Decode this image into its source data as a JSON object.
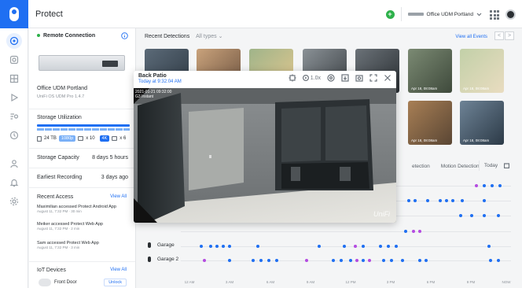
{
  "app": {
    "title": "Protect"
  },
  "topbar": {
    "console_name": "Office UDM Portland"
  },
  "panel": {
    "remote": {
      "label": "Remote Connection"
    },
    "device": {
      "name": "Office UDM Portland",
      "model": "UniFi OS UDM Pro 1.4.7"
    },
    "storage": {
      "title": "Storage Utilization",
      "capacity_label": "24 TB",
      "chip_1080": "1080p",
      "count_1080": "x 10",
      "chip_4k": "4K",
      "count_4k": "x 6"
    },
    "capacity": {
      "label": "Storage Capacity",
      "value": "8 days 5 hours"
    },
    "earliest": {
      "label": "Earliest Recording",
      "value": "3 days ago"
    },
    "recent_access": {
      "title": "Recent Access",
      "view_all": "View All",
      "items": [
        {
          "text": "Maximilian accessed Protect Android App",
          "time": "August 11, 7:32 PM · 30 min"
        },
        {
          "text": "Meiker accessed Protect Web App",
          "time": "August 11, 7:32 PM · 2 min"
        },
        {
          "text": "Sam accessed Protect Web App",
          "time": "August 11, 7:32 PM · 3 min"
        }
      ]
    },
    "iot": {
      "title": "IoT Devices",
      "view_all": "View All",
      "device": "Front Door",
      "action": "Unlock"
    }
  },
  "detections": {
    "title": "Recent Detections",
    "filter": "All types",
    "view_all": "View all Events",
    "pager_prev": "<",
    "pager_next": ">",
    "thumb_labels": [
      "Apr 18, 08:08am",
      "Apr 18, 08:08am",
      "Apr 18, 08:08am",
      "Apr 18, 08:08am"
    ]
  },
  "events": {
    "tab_detection": "etection",
    "tab_motion": "Motion Detection",
    "today": "Today",
    "cameras": [
      "Garage",
      "Garage 2"
    ],
    "axis_labels": [
      "12 AM",
      "3 AM",
      "6 AM",
      "9 AM",
      "12 PM",
      "3 PM",
      "6 PM",
      "9 PM",
      "NOW"
    ]
  },
  "popup": {
    "title": "Back Patio",
    "time": "Today at 9:32:04 AM",
    "speed": "1.0x",
    "stamp_date": "2021-01-21 09:32:00",
    "stamp_cam": "G3 Instant",
    "watermark": "UniFi"
  },
  "colors": {
    "accent": "#1f6ff2",
    "motion": "#1f6ff2",
    "person": "#b44be1",
    "success": "#2db14a"
  }
}
